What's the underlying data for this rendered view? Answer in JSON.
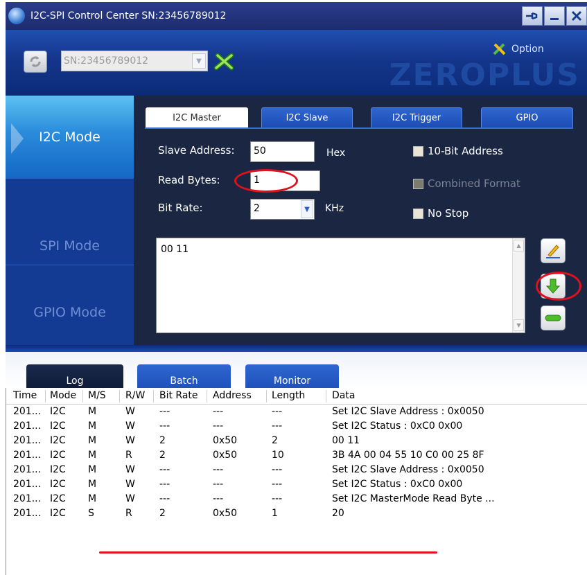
{
  "window": {
    "title": "I2C-SPI Control Center SN:23456789012"
  },
  "header": {
    "serial_select": "SN:23456789012",
    "option_label": "Option",
    "brand": "ZEROPLUS"
  },
  "sidebar": {
    "items": [
      {
        "label": "I2C Mode"
      },
      {
        "label": "SPI Mode"
      },
      {
        "label": "GPIO Mode"
      }
    ]
  },
  "tabs": [
    {
      "label": "I2C Master"
    },
    {
      "label": "I2C Slave"
    },
    {
      "label": "I2C Trigger"
    },
    {
      "label": "GPIO"
    }
  ],
  "form": {
    "slave_address_label": "Slave Address:",
    "slave_address_value": "50",
    "hex_label": "Hex",
    "read_bytes_label": "Read Bytes:",
    "read_bytes_value": "1",
    "bit_rate_label": "Bit Rate:",
    "bit_rate_value": "2",
    "khz_label": "KHz",
    "ten_bit_label": "10-Bit Address",
    "combined_label": "Combined Format",
    "no_stop_label": "No Stop",
    "data_value": "00 11"
  },
  "bottom_tabs": [
    {
      "label": "Log"
    },
    {
      "label": "Batch"
    },
    {
      "label": "Monitor"
    }
  ],
  "log": {
    "columns": [
      "Time",
      "Mode",
      "M/S",
      "R/W",
      "Bit Rate",
      "Address",
      "Length",
      "Data"
    ],
    "rows": [
      [
        "201...",
        "I2C",
        "M",
        "W",
        "---",
        "---",
        "---",
        "Set I2C Slave Address : 0x0050"
      ],
      [
        "201...",
        "I2C",
        "M",
        "W",
        "---",
        "---",
        "---",
        "Set I2C Status : 0xC0 0x00"
      ],
      [
        "201...",
        "I2C",
        "M",
        "W",
        "2",
        "0x50",
        "2",
        "00 11"
      ],
      [
        "201...",
        "I2C",
        "M",
        "R",
        "2",
        "0x50",
        "10",
        "3B 4A 00 04 55 10 C0 00 25 8F"
      ],
      [
        "201...",
        "I2C",
        "M",
        "W",
        "---",
        "---",
        "---",
        "Set I2C Slave Address : 0x0050"
      ],
      [
        "201...",
        "I2C",
        "M",
        "W",
        "---",
        "---",
        "---",
        "Set I2C Status : 0xC0 0x00"
      ],
      [
        "201...",
        "I2C",
        "M",
        "W",
        "---",
        "---",
        "---",
        "Set I2C MasterMode Read Byte ..."
      ],
      [
        "201...",
        "I2C",
        "S",
        "R",
        "2",
        "0x50",
        "1",
        "20"
      ]
    ]
  },
  "colors": {
    "accent_blue": "#1f52bc",
    "highlight_red": "#e0101c"
  }
}
